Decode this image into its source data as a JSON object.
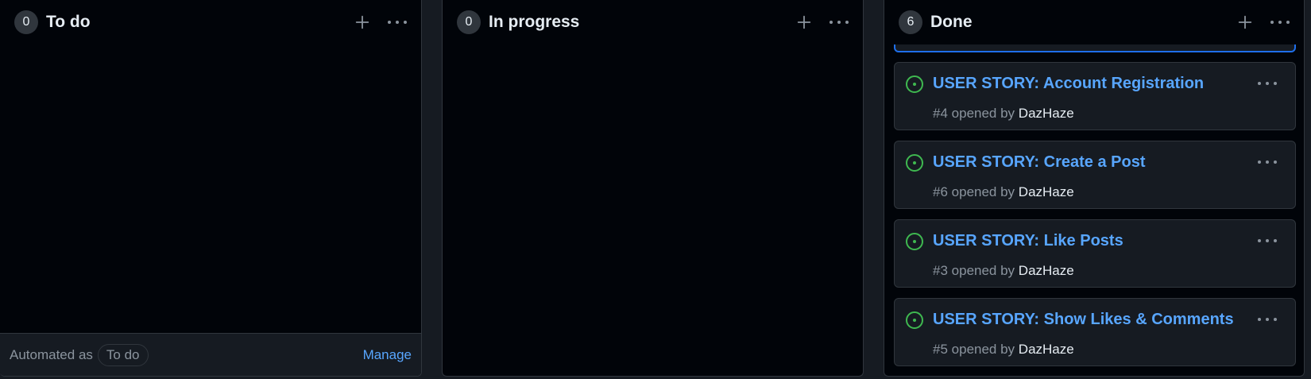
{
  "columns": {
    "todo": {
      "count": "0",
      "title": "To do",
      "footer": {
        "automated_label": "Automated as",
        "automated_value": "To do",
        "manage_label": "Manage"
      }
    },
    "in_progress": {
      "count": "0",
      "title": "In progress"
    },
    "done": {
      "count": "6",
      "title": "Done",
      "cards": [
        {
          "title": "USER STORY: Account Registration",
          "number": "#4",
          "opened_by": "opened by",
          "author": "DazHaze"
        },
        {
          "title": "USER STORY: Create a Post",
          "number": "#6",
          "opened_by": "opened by",
          "author": "DazHaze"
        },
        {
          "title": "USER STORY: Like Posts",
          "number": "#3",
          "opened_by": "opened by",
          "author": "DazHaze"
        },
        {
          "title": "USER STORY: Show Likes & Comments",
          "number": "#5",
          "opened_by": "opened by",
          "author": "DazHaze"
        }
      ]
    }
  },
  "icons": {
    "add": "plus-icon",
    "menu": "kebab-horizontal-icon",
    "issue": "issue-opened-icon"
  },
  "colors": {
    "accent": "#58a6ff",
    "issue_open": "#3fb950",
    "selection": "#1f6feb"
  }
}
